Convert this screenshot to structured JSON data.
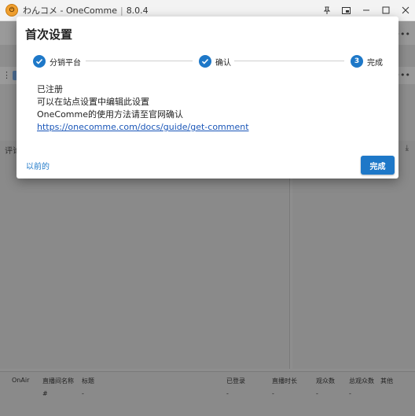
{
  "window": {
    "title": "わんコメ - OneComme",
    "version": "8.0.4"
  },
  "dialog": {
    "title": "首次设置",
    "steps": [
      {
        "label": "分销平台",
        "state": "done"
      },
      {
        "label": "确认",
        "state": "done"
      },
      {
        "label": "完成",
        "state": "active",
        "number": "3"
      }
    ],
    "lines": [
      "已注册",
      "可以在站点设置中编辑此设置",
      "OneComme的使用方法请至官网确认"
    ],
    "link": "https://onecomme.com/docs/guide/get-comment",
    "back_label": "以前的",
    "done_label": "完成"
  },
  "background": {
    "comment_label": "评论",
    "table": {
      "headers": [
        "OnAir",
        "直播间名称",
        "标题",
        "已登录",
        "直播时长",
        "观众数",
        "总观众数",
        "其他"
      ],
      "row": [
        "",
        "#",
        "-",
        "-",
        "-",
        "-",
        "-",
        ""
      ]
    }
  },
  "colors": {
    "accent": "#1e78c8",
    "link": "#1a56b8"
  }
}
